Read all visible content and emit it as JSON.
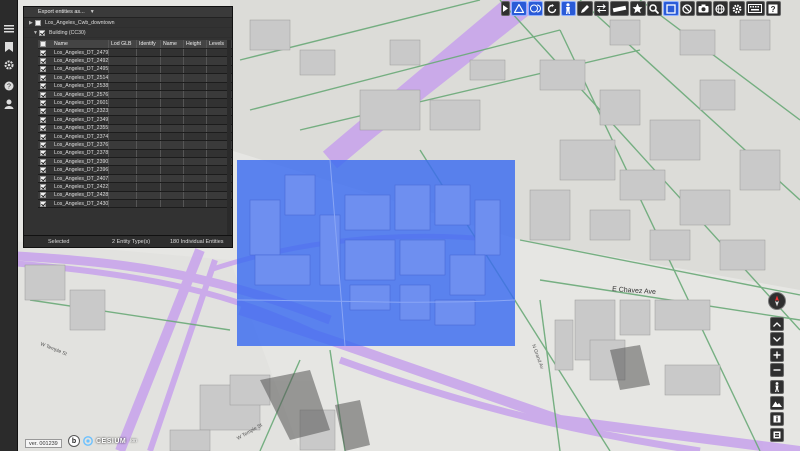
{
  "panel": {
    "export_label": "Export entities as...",
    "layers": [
      {
        "name": "Los_Angeles_Cwb_downtown",
        "expanded": false,
        "checked": false
      },
      {
        "name": "Building (CC30)",
        "expanded": true,
        "checked": true
      }
    ],
    "columns": [
      "Name",
      "Lod GLB",
      "Identify",
      "Name",
      "Height",
      "Levels"
    ],
    "rows": [
      "Los_Angeles_DT_2479",
      "Los_Angeles_DT_2492",
      "Los_Angeles_DT_2495",
      "Los_Angeles_DT_2514",
      "Los_Angeles_DT_2538",
      "Los_Angeles_DT_2576",
      "Los_Angeles_DT_2601",
      "Los_Angeles_DT_2323",
      "Los_Angeles_DT_2349",
      "Los_Angeles_DT_2355",
      "Los_Angeles_DT_2374",
      "Los_Angeles_DT_2376",
      "Los_Angeles_DT_2378",
      "Los_Angeles_DT_2390",
      "Los_Angeles_DT_2396",
      "Los_Angeles_DT_2407",
      "Los_Angeles_DT_2422",
      "Los_Angeles_DT_2428",
      "Los_Angeles_DT_2430"
    ],
    "status": {
      "selected": "Selected",
      "types": "2 Entity Type(s)",
      "entities": "180 Individual Entities"
    }
  },
  "map": {
    "street_labels": [
      "E Chavez Ave",
      "W Temple St",
      "W Temple St",
      "N Grand Av"
    ],
    "selection_color": "#3a6bf0",
    "route_color": "#c49aea"
  },
  "toolbar": {
    "icons": [
      "play-icon",
      "triangle-icon",
      "layers-toggle-icon",
      "rotate-icon",
      "person-icon",
      "pencil-icon",
      "swap-icon",
      "ruler-icon",
      "star-icon",
      "search-icon",
      "select-box-icon",
      "cancel-icon",
      "camera-icon",
      "globe-icon",
      "gear-icon",
      "keyboard-icon",
      "help-icon"
    ],
    "active": [
      "triangle-icon",
      "layers-toggle-icon",
      "person-icon",
      "select-box-icon"
    ]
  },
  "footer": {
    "version": "ver. 001239",
    "logo_text": "CESIUM",
    "logo_sub": "ion"
  }
}
